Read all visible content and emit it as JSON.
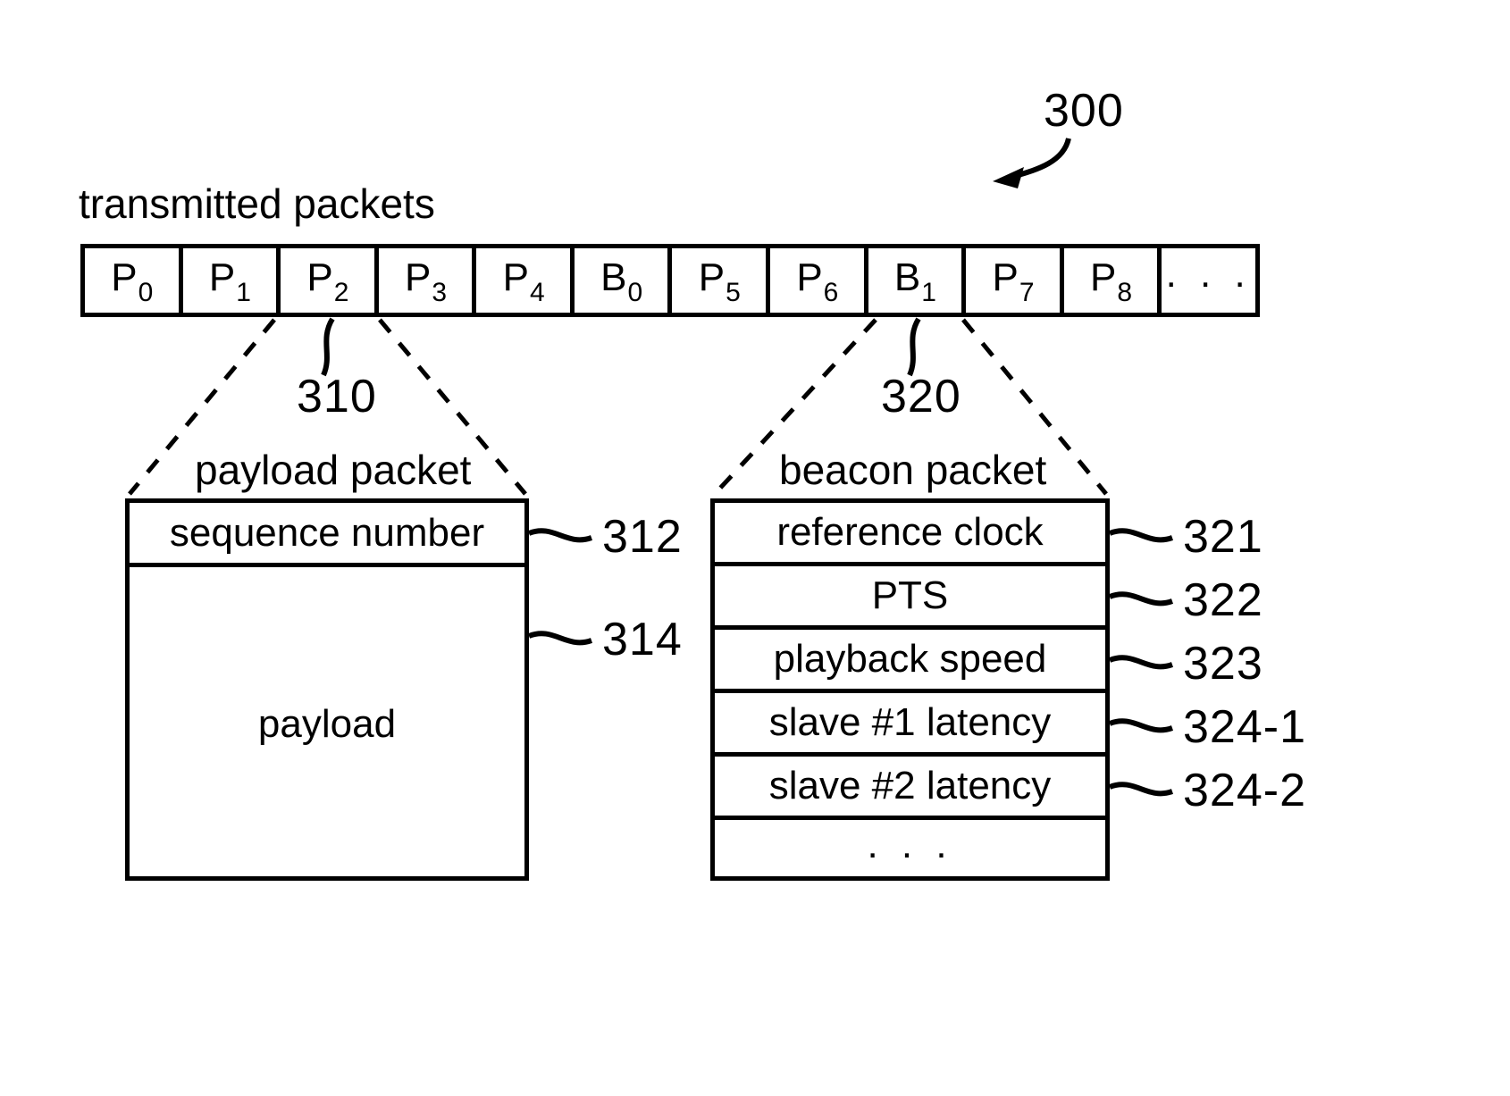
{
  "figure": {
    "figure_ref": "300",
    "strip_title": "transmitted packets",
    "packets": [
      {
        "base": "P",
        "sub": "0"
      },
      {
        "base": "P",
        "sub": "1"
      },
      {
        "base": "P",
        "sub": "2"
      },
      {
        "base": "P",
        "sub": "3"
      },
      {
        "base": "P",
        "sub": "4"
      },
      {
        "base": "B",
        "sub": "0"
      },
      {
        "base": "P",
        "sub": "5"
      },
      {
        "base": "P",
        "sub": "6"
      },
      {
        "base": "B",
        "sub": "1"
      },
      {
        "base": "P",
        "sub": "7"
      },
      {
        "base": "P",
        "sub": "8"
      }
    ],
    "packets_more": ". . ."
  },
  "payload_packet": {
    "ref": "310",
    "caption": "payload packet",
    "fields": [
      {
        "label": "sequence number",
        "ref": "312"
      },
      {
        "label": "payload",
        "ref": "314"
      }
    ]
  },
  "beacon_packet": {
    "ref": "320",
    "caption": "beacon packet",
    "fields": [
      {
        "label": "reference clock",
        "ref": "321"
      },
      {
        "label": "PTS",
        "ref": "322"
      },
      {
        "label": "playback speed",
        "ref": "323"
      },
      {
        "label": "slave #1 latency",
        "ref": "324-1"
      },
      {
        "label": "slave #2 latency",
        "ref": "324-2"
      }
    ],
    "more": ". . ."
  }
}
